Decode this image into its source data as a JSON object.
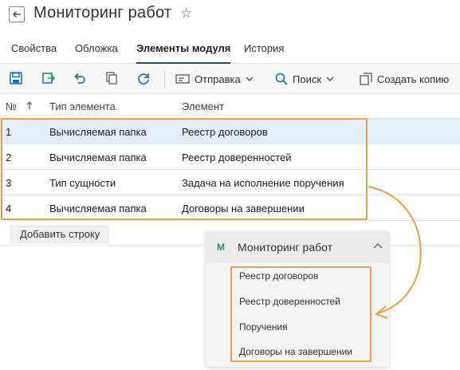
{
  "header": {
    "title": "Мониторинг работ",
    "back_icon": "arrow-left-icon",
    "favorite_icon": "star-outline-icon"
  },
  "tabs": [
    {
      "label": "Свойства",
      "active": false
    },
    {
      "label": "Обложка",
      "active": false
    },
    {
      "label": "Элементы модуля",
      "active": true
    },
    {
      "label": "История",
      "active": false
    }
  ],
  "toolbar": {
    "icons": [
      "save-icon",
      "save-and-close-icon",
      "undo-icon",
      "copy-icon",
      "refresh-icon"
    ],
    "send_label": "Отправка",
    "search_label": "Поиск",
    "create_copy_label": "Создать копию",
    "accent_color": "#1b6fb5"
  },
  "table": {
    "columns": {
      "num": "№",
      "type": "Тип элемента",
      "element": "Элемент"
    },
    "rows": [
      {
        "num": "1",
        "type": "Вычисляемая папка",
        "element": "Реестр договоров"
      },
      {
        "num": "2",
        "type": "Вычисляемая папка",
        "element": "Реестр доверенностей"
      },
      {
        "num": "3",
        "type": "Тип сущности",
        "element": "Задача на исполнение поручения"
      },
      {
        "num": "4",
        "type": "Вычисляемая папка",
        "element": "Договоры на завершении"
      }
    ],
    "selected_row": 1,
    "selected_color": "#e3eef8",
    "add_row_label": "Добавить строку"
  },
  "menu_preview": {
    "letter": "M",
    "title": "Мониторинг работ",
    "items": [
      "Реестр договоров",
      "Реестр доверенностей",
      "Поручения",
      "Договоры на завершении"
    ]
  },
  "highlight_color": "#ee9d4a"
}
